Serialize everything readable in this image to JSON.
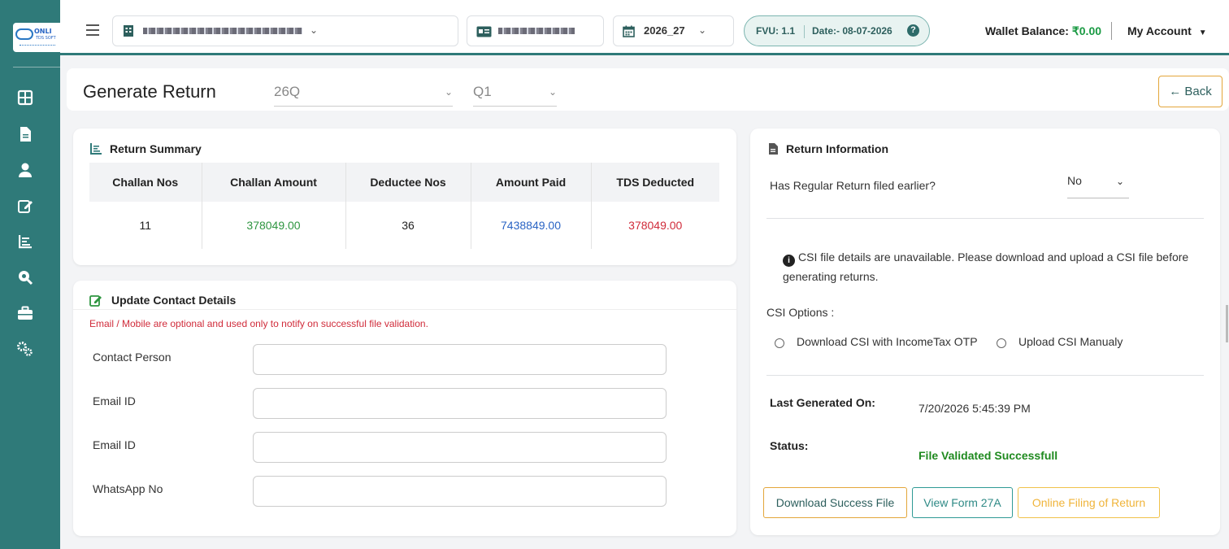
{
  "brand": {
    "line1": "ONLI",
    "line2": "TDS SOFT"
  },
  "topbar": {
    "financial_year": "2026_27",
    "fvu_label": "FVU: 1.1",
    "date_label": "Date:- 08-07-2026",
    "help_glyph": "?",
    "wallet_label": "Wallet Balance:",
    "wallet_amount": "₹0.00",
    "account_label": "My Account"
  },
  "header": {
    "title": "Generate Return",
    "form_select": "26Q",
    "quarter_select": "Q1",
    "back_label": "Back"
  },
  "summary": {
    "title": "Return Summary",
    "columns": [
      "Challan Nos",
      "Challan Amount",
      "Deductee Nos",
      "Amount Paid",
      "TDS Deducted"
    ],
    "values": [
      "11",
      "378049.00",
      "36",
      "7438849.00",
      "378049.00"
    ]
  },
  "contact": {
    "title": "Update Contact Details",
    "note": "Email / Mobile are optional and used only to notify on successful file validation.",
    "fields": [
      "Contact Person",
      "Email ID",
      "Email ID",
      "WhatsApp No"
    ]
  },
  "return_info": {
    "title": "Return Information",
    "regular_question": "Has Regular Return filed earlier?",
    "regular_value": "No",
    "csi_message": "CSI file details are unavailable. Please download and upload a CSI file before generating returns.",
    "csi_options_label": "CSI Options :",
    "csi_option_1": "Download CSI with IncomeTax OTP",
    "csi_option_2": "Upload CSI Manualy",
    "last_generated_label": "Last Generated On:",
    "last_generated_value": "7/20/2026 5:45:39 PM",
    "status_label": "Status:",
    "status_value": "File Validated Successfull",
    "buttons": [
      "Download Success File",
      "View Form 27A",
      "Online Filing of Return"
    ]
  },
  "colors": {
    "teal": "#2f7a79",
    "green": "#2e9540",
    "blue": "#2a64c4",
    "red": "#d02b3a",
    "orange": "#e3a63a"
  }
}
